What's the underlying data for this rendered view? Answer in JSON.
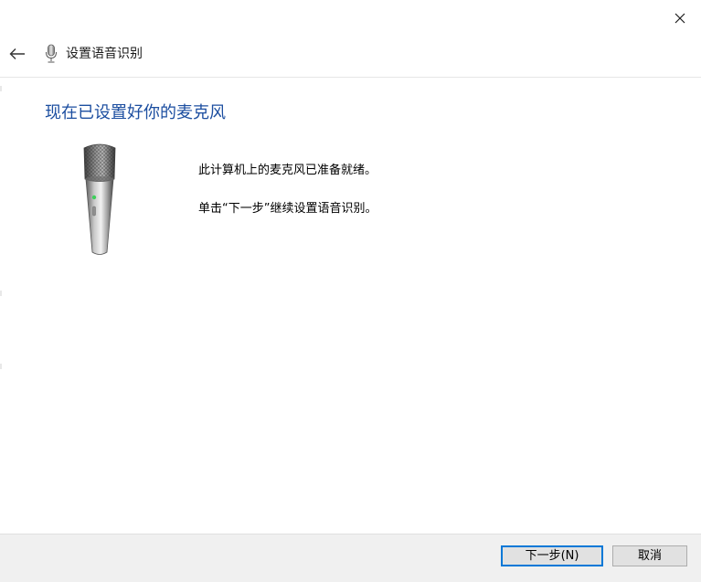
{
  "window": {
    "close_label": "×"
  },
  "header": {
    "back_label": "←",
    "title": "设置语音识别",
    "icon": "microphone-icon"
  },
  "main": {
    "heading": "现在已设置好你的麦克风",
    "image": "microphone-illustration",
    "messages": [
      "此计算机上的麦克风已准备就绪。",
      "单击“下一步”继续设置语音识别。"
    ]
  },
  "footer": {
    "next_label": "下一步(N)",
    "cancel_label": "取消"
  },
  "colors": {
    "heading": "#1c4ea0",
    "primary_border": "#0078d7",
    "footer_bg": "#f0f0f0"
  }
}
